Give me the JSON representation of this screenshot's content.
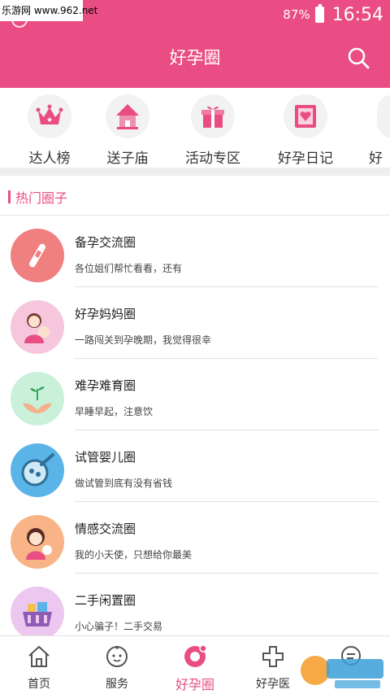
{
  "watermark": "乐游网 www.962.net",
  "status_bar": {
    "battery": "87%",
    "time": "16:54"
  },
  "header": {
    "title": "好孕圈"
  },
  "categories": [
    {
      "label": "达人榜",
      "icon": "crown-icon"
    },
    {
      "label": "送子庙",
      "icon": "temple-icon"
    },
    {
      "label": "活动专区",
      "icon": "gift-icon"
    },
    {
      "label": "好孕日记",
      "icon": "diary-icon"
    },
    {
      "label": "好",
      "icon": "more-icon"
    }
  ],
  "section": {
    "title": "热门圈子"
  },
  "circles": [
    {
      "name": "备孕交流圈",
      "desc": "各位姐们帮忙看看，还有",
      "color": "#f07f80",
      "icon": "pregnancy-test-icon"
    },
    {
      "name": "好孕妈妈圈",
      "desc": "一路闯关到孕晚期，我觉得很幸",
      "color": "#f6c7dc",
      "icon": "mother-baby-icon"
    },
    {
      "name": "难孕难育圈",
      "desc": "早睡早起，注意饮",
      "color": "#c9f1d9",
      "icon": "sprout-hands-icon"
    },
    {
      "name": "试管婴儿圈",
      "desc": "做试管到底有没有省钱",
      "color": "#5ab4e8",
      "icon": "petri-dish-icon"
    },
    {
      "name": "情感交流圈",
      "desc": "我的小天使，只想给你最美",
      "color": "#f8b487",
      "icon": "girl-icon"
    },
    {
      "name": "二手闲置圈",
      "desc": "小心骗子！二手交易",
      "color": "#ecc7ef",
      "icon": "basket-icon"
    }
  ],
  "tabs": [
    {
      "label": "首页",
      "icon": "home-icon",
      "active": false
    },
    {
      "label": "服务",
      "icon": "baby-face-icon",
      "active": false
    },
    {
      "label": "好孕圈",
      "icon": "circle-logo-icon",
      "active": true
    },
    {
      "label": "好孕医",
      "icon": "medical-cross-icon",
      "active": false
    },
    {
      "label": "",
      "icon": "message-icon",
      "active": false
    }
  ],
  "colors": {
    "brand": "#e94d83",
    "band": "#eeeeee"
  }
}
